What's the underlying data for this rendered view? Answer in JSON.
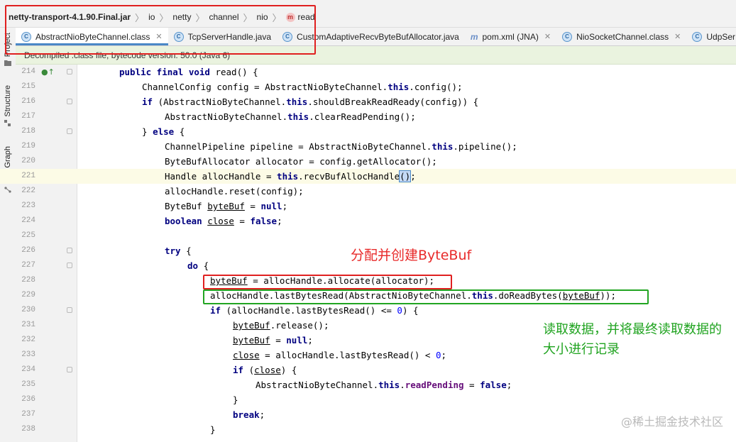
{
  "breadcrumb": [
    "netty-transport-4.1.90.Final.jar",
    "io",
    "netty",
    "channel",
    "nio",
    "read"
  ],
  "sidebar": {
    "project": "Project",
    "structure": "Structure",
    "call_graph": "Call Graph"
  },
  "tabs": [
    {
      "label": "AbstractNioByteChannel.class",
      "icon": "class-icon",
      "active": true,
      "closable": true
    },
    {
      "label": "TcpServerHandle.java",
      "icon": "class-icon",
      "active": false,
      "closable": false
    },
    {
      "label": "CustomAdaptiveRecvByteBufAllocator.java",
      "icon": "class-icon",
      "active": false,
      "closable": false
    },
    {
      "label": "pom.xml (JNA)",
      "icon": "maven-icon",
      "active": false,
      "closable": true
    },
    {
      "label": "NioSocketChannel.class",
      "icon": "class-icon",
      "active": false,
      "closable": true
    },
    {
      "label": "UdpSer",
      "icon": "class-icon",
      "active": false,
      "closable": false
    }
  ],
  "banner": "Decompiled .class file, bytecode version: 50.0 (Java 6)",
  "code": {
    "current_line": "221",
    "line_numbers": [
      "214",
      "215",
      "216",
      "217",
      "218",
      "219",
      "220",
      "221",
      "222",
      "223",
      "224",
      "225",
      "226",
      "227",
      "228",
      "229",
      "230",
      "231",
      "232",
      "233",
      "234",
      "235",
      "236",
      "237",
      "238"
    ]
  },
  "annotations": {
    "allocate": "分配并创建ByteBuf",
    "read_record": "读取数据，并将最终读取数据的大小进行记录"
  },
  "watermark": "@稀土掘金技术社区",
  "colors": {
    "keyword": "#000080",
    "field": "#660e7a",
    "number": "#0000ff",
    "annotation_red": "#e82a2a",
    "annotation_green": "#1fa31f",
    "highlight_box_red": "#e02020",
    "highlight_box_green": "#22a522"
  }
}
